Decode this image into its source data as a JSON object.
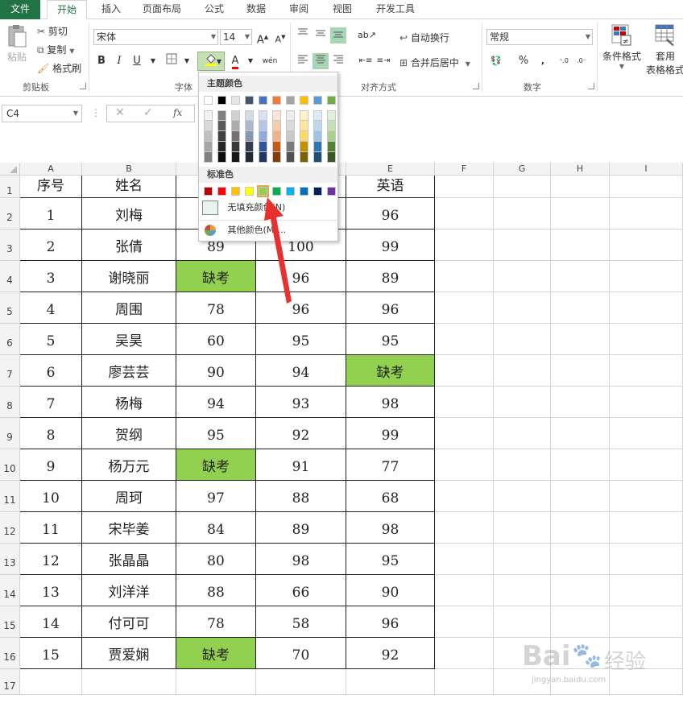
{
  "tabs": [
    "文件",
    "开始",
    "插入",
    "页面布局",
    "公式",
    "数据",
    "审阅",
    "视图",
    "开发工具"
  ],
  "ribbon": {
    "clipboard": {
      "paste": "粘贴",
      "cut": "剪切",
      "copy": "复制",
      "format_painter": "格式刷",
      "label": "剪贴板"
    },
    "font": {
      "name": "宋体",
      "size": "14",
      "label": "字体",
      "bold": "B",
      "italic": "I",
      "underline": "U"
    },
    "alignment": {
      "wrap": "自动换行",
      "merge": "合并后居中",
      "label": "对齐方式"
    },
    "number": {
      "format": "常规",
      "label": "数字",
      "percent": "%"
    },
    "styles": {
      "conditional": "条件格式",
      "table_line1": "套用",
      "table_line2": "表格格式"
    }
  },
  "namebox": "C4",
  "palette": {
    "theme_title": "主题颜色",
    "standard_title": "标准色",
    "no_fill": "无填充颜色(N)",
    "more_colors": "其他颜色(M)...",
    "theme_top": [
      "#ffffff",
      "#000000",
      "#e7e6e6",
      "#44546a",
      "#4472c4",
      "#ed7d31",
      "#a5a5a5",
      "#ffc000",
      "#5b9bd5",
      "#70ad47"
    ],
    "theme_shades": [
      [
        "#f2f2f2",
        "#808080",
        "#d0cece",
        "#d6dce4",
        "#d9e2f3",
        "#fbe5d6",
        "#ededed",
        "#fff2cc",
        "#deebf7",
        "#e2f0d9"
      ],
      [
        "#d9d9d9",
        "#595959",
        "#aeabab",
        "#adb9ca",
        "#b4c7e7",
        "#f8cbad",
        "#dbdbdb",
        "#ffe699",
        "#bdd7ee",
        "#c5e0b4"
      ],
      [
        "#bfbfbf",
        "#404040",
        "#757171",
        "#8497b0",
        "#8faadc",
        "#f4b183",
        "#c9c9c9",
        "#ffd966",
        "#9dc3e6",
        "#a9d18e"
      ],
      [
        "#a6a6a6",
        "#262626",
        "#3b3838",
        "#333f50",
        "#2f5597",
        "#c55a11",
        "#7b7b7b",
        "#bf9000",
        "#2e75b6",
        "#538135"
      ],
      [
        "#808080",
        "#0d0d0d",
        "#171616",
        "#222a35",
        "#203864",
        "#843c0c",
        "#525252",
        "#7f6000",
        "#1f4e79",
        "#385723"
      ]
    ],
    "standard": [
      "#c00000",
      "#ff0000",
      "#ffc000",
      "#ffff00",
      "#92d050",
      "#00b050",
      "#00b0f0",
      "#0070c0",
      "#002060",
      "#7030a0"
    ]
  },
  "columns": [
    "A",
    "B",
    "C",
    "D",
    "E",
    "F",
    "G",
    "H",
    "I"
  ],
  "rows": [
    "1",
    "2",
    "3",
    "4",
    "5",
    "6",
    "7",
    "8",
    "9",
    "10",
    "11",
    "12",
    "13",
    "14",
    "15",
    "16",
    "17"
  ],
  "header_row": [
    "序号",
    "姓名",
    "",
    "",
    "英语"
  ],
  "data_rows": [
    [
      "1",
      "刘梅",
      "",
      "",
      "96"
    ],
    [
      "2",
      "张倩",
      "89",
      "100",
      "99"
    ],
    [
      "3",
      "谢晓丽",
      "缺考",
      "96",
      "89"
    ],
    [
      "4",
      "周围",
      "78",
      "96",
      "96"
    ],
    [
      "5",
      "吴昊",
      "60",
      "95",
      "95"
    ],
    [
      "6",
      "廖芸芸",
      "90",
      "94",
      "缺考"
    ],
    [
      "7",
      "杨梅",
      "94",
      "93",
      "98"
    ],
    [
      "8",
      "贺纲",
      "95",
      "92",
      "99"
    ],
    [
      "9",
      "杨万元",
      "缺考",
      "91",
      "77"
    ],
    [
      "10",
      "周珂",
      "97",
      "88",
      "68"
    ],
    [
      "11",
      "宋毕姜",
      "84",
      "89",
      "98"
    ],
    [
      "12",
      "张晶晶",
      "80",
      "98",
      "95"
    ],
    [
      "13",
      "刘洋洋",
      "88",
      "66",
      "90"
    ],
    [
      "14",
      "付可可",
      "78",
      "58",
      "96"
    ],
    [
      "15",
      "贾爱娴",
      "缺考",
      "70",
      "92"
    ]
  ],
  "highlight_color": "#92d050",
  "accent": "#217346",
  "watermark": {
    "brand": "Bai",
    "brand2": "经验",
    "url": "jingyan.baidu.com"
  }
}
